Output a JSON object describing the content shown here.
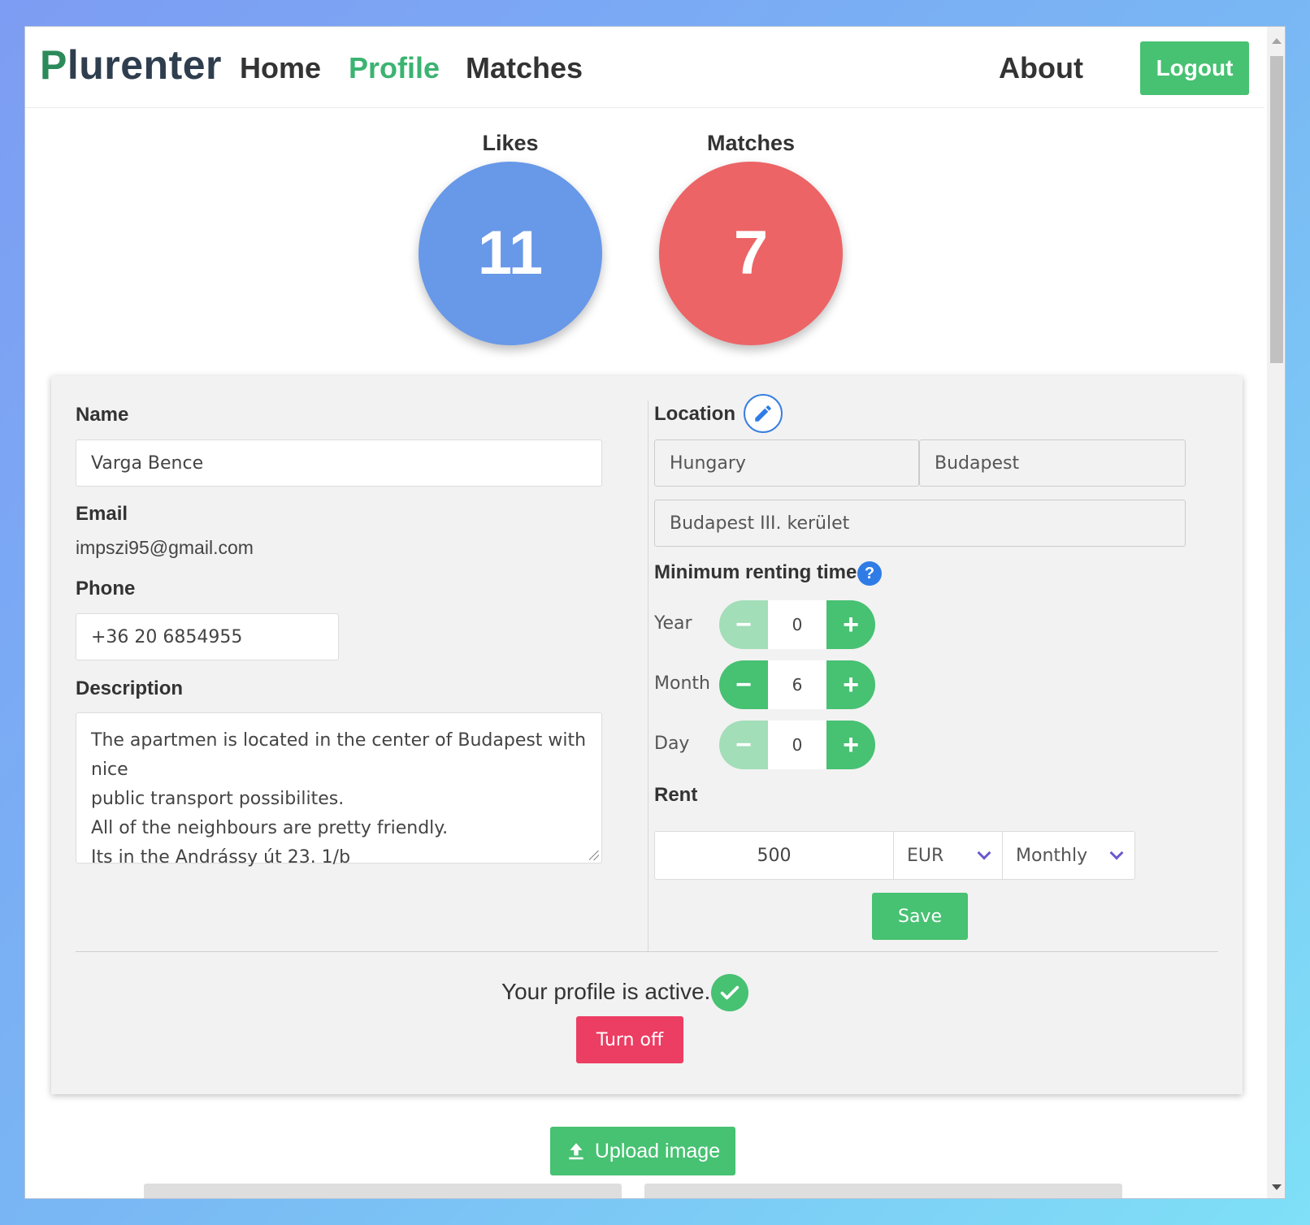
{
  "nav": {
    "brand": "Plurenter",
    "links": [
      "Home",
      "Profile",
      "Matches",
      "About"
    ],
    "active": "Profile",
    "logout_label": "Logout",
    "accent_color": "#3cb371"
  },
  "stats": {
    "likes_label": "Likes",
    "likes_value": "11",
    "matches_label": "Matches",
    "matches_value": "7",
    "likes_color": "#6898e8",
    "matches_color": "#ec6466"
  },
  "profile": {
    "name_label": "Name",
    "name_value": "Varga Bence",
    "email_label": "Email",
    "email_value": "impszi95@gmail.com",
    "phone_label": "Phone",
    "phone_value": "+36 20 6854955",
    "description_label": "Description",
    "description_lines": [
      "The apartmen is located in the center of Budapest with nice",
      "public transport possibilites.",
      "All of the neighbours are pretty friendly.",
      "Its in the Andrássy út 23. 1/b"
    ]
  },
  "location": {
    "label": "Location",
    "country": "Hungary",
    "city": "Budapest",
    "district": "Budapest III. kerület",
    "edit_icon": "pencil-icon"
  },
  "renting_time": {
    "label": "Minimum renting time",
    "help_icon": "question-icon",
    "help_glyph": "?",
    "year_label": "Year",
    "year_value": "0",
    "month_label": "Month",
    "month_value": "6",
    "day_label": "Day",
    "day_value": "0",
    "minus_glyph": "−",
    "plus_glyph": "+"
  },
  "rent": {
    "label": "Rent",
    "amount": "500",
    "currency": "EUR",
    "period": "Monthly"
  },
  "actions": {
    "save_label": "Save",
    "status_text": "Your profile is active.",
    "turn_off_label": "Turn off",
    "upload_label": "Upload image"
  }
}
